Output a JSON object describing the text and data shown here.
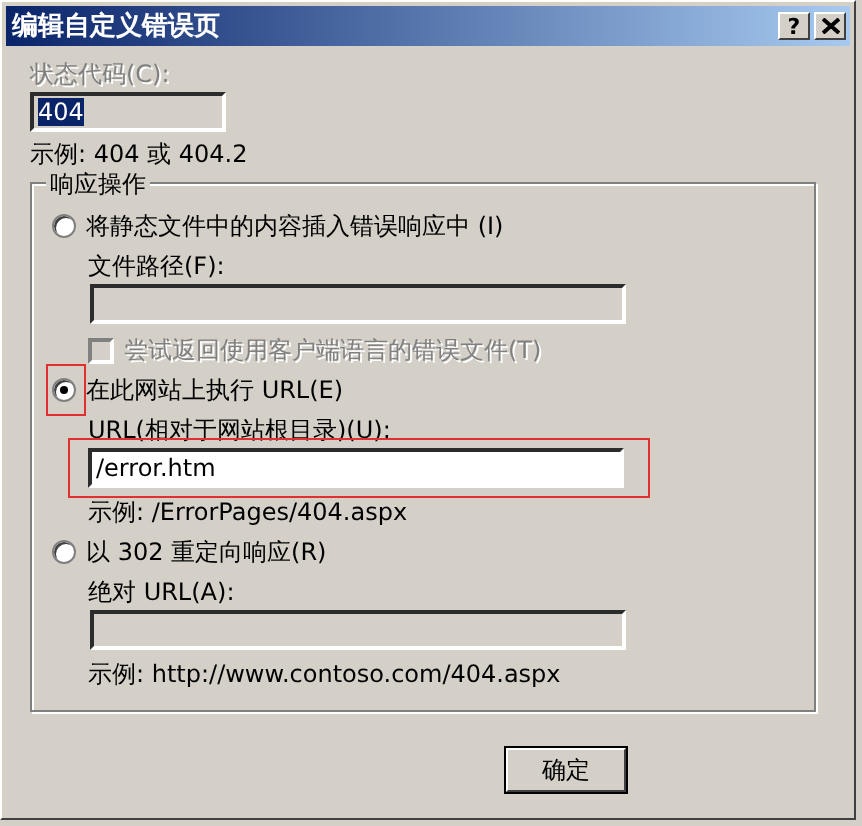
{
  "window": {
    "title": "编辑自定义错误页",
    "help": "?"
  },
  "status_code": {
    "label": "状态代码(C):",
    "value": "404",
    "disabled": true,
    "value_selected": true,
    "example": "示例: 404 或 404.2"
  },
  "response_group": {
    "title": "响应操作",
    "options": [
      {
        "label": "将静态文件中的内容插入错误响应中 (I)",
        "selected": false,
        "annotated": false,
        "items": [
          {
            "kind": "field",
            "label": "文件路径(F):",
            "disabled": true,
            "annotated": false
          },
          {
            "kind": "checkbox",
            "label": "尝试返回使用客户端语言的错误文件(T)",
            "checked": false,
            "disabled": true
          }
        ]
      },
      {
        "label": "在此网站上执行 URL(E)",
        "selected": true,
        "annotated": true,
        "items": [
          {
            "kind": "field",
            "label": "URL(相对于网站根目录)(U):",
            "value": "/error.htm",
            "disabled": false,
            "annotated": true
          },
          {
            "kind": "example",
            "text": "示例: /ErrorPages/404.aspx"
          }
        ]
      },
      {
        "label": "以 302 重定向响应(R)",
        "selected": false,
        "annotated": false,
        "items": [
          {
            "kind": "field",
            "label": "绝对 URL(A):",
            "disabled": true,
            "annotated": false
          },
          {
            "kind": "example",
            "text": "示例: http://www.contoso.com/404.aspx"
          }
        ]
      }
    ]
  },
  "buttons": [
    {
      "label": "确定"
    }
  ]
}
